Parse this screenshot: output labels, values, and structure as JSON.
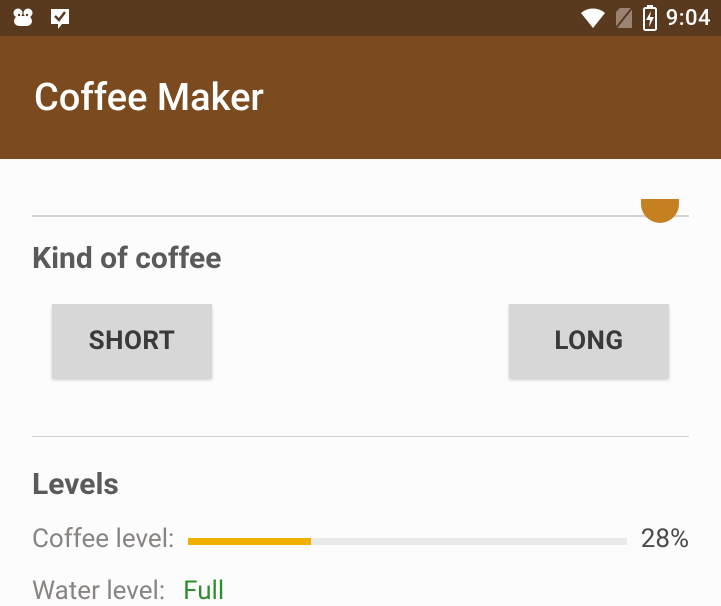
{
  "statusBar": {
    "time": "9:04"
  },
  "appBar": {
    "title": "Coffee Maker"
  },
  "sections": {
    "kindOfCoffee": {
      "title": "Kind of coffee",
      "shortLabel": "SHORT",
      "longLabel": "LONG"
    },
    "levels": {
      "title": "Levels",
      "coffee": {
        "label": "Coffee level:",
        "percent": 28,
        "display": "28%"
      },
      "water": {
        "label": "Water level:",
        "status": "Full"
      }
    }
  }
}
